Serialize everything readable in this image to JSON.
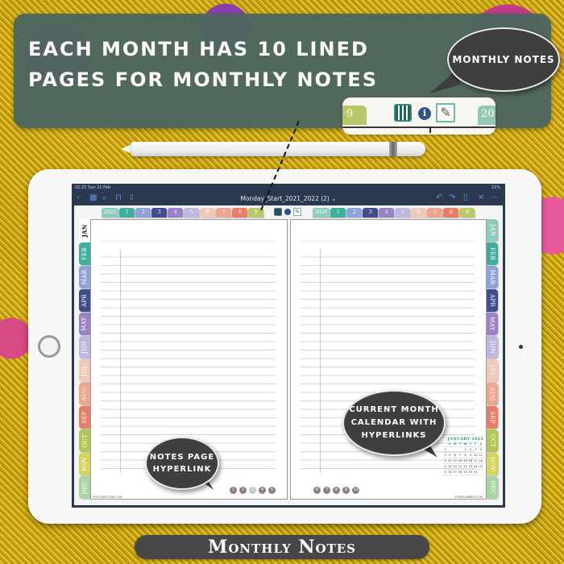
{
  "banner": {
    "title": "EACH MONTH HAS 10 LINED PAGES FOR MONTHLY NOTES",
    "zoom_strip": {
      "tab_left": "9",
      "tab_right": "20"
    }
  },
  "callouts": {
    "monthly_notes": "MONTHLY NOTES",
    "notes_page_hyperlink": "NOTES PAGE HYPERLINK",
    "current_month_calendar": "CURRENT MONTH CALENDAR WITH HYPERLINKS"
  },
  "app": {
    "status_time": "02:25",
    "status_date": "Sun 21 Feb",
    "status_right": "21%",
    "document_title": "Monday_Start_2021_2022 (2) ⌄",
    "toolbar_left_icons": [
      "back-icon",
      "grid-icon",
      "search-icon",
      "bookmark-icon",
      "share-icon"
    ],
    "toolbar_right_icons": [
      "undo-icon",
      "redo-icon",
      "export-icon",
      "close-icon",
      "more-icon"
    ]
  },
  "planner": {
    "left_page": {
      "year_tabs": [
        {
          "label": "2025",
          "color": "#8fcbbd"
        },
        {
          "label": "1",
          "color": "#3fae9f"
        },
        {
          "label": "2",
          "color": "#8fa3d6"
        },
        {
          "label": "3",
          "color": "#414c8c"
        },
        {
          "label": "4",
          "color": "#9b82c6"
        },
        {
          "label": "5",
          "color": "#c0b7e0"
        },
        {
          "label": "6",
          "color": "#f0c9b8"
        },
        {
          "label": "7",
          "color": "#eea58f"
        },
        {
          "label": "8",
          "color": "#e77d66"
        },
        {
          "label": "9",
          "color": "#b9c86a"
        }
      ],
      "month_tabs": [
        {
          "label": "JAN",
          "color": "#ffffff",
          "active": true
        },
        {
          "label": "FEB",
          "color": "#3fae9f"
        },
        {
          "label": "MAR",
          "color": "#8fa3d6"
        },
        {
          "label": "APR",
          "color": "#414c8c"
        },
        {
          "label": "MAY",
          "color": "#9b82c6"
        },
        {
          "label": "JUN",
          "color": "#c0b7e0"
        },
        {
          "label": "JUL",
          "color": "#f0c9b8"
        },
        {
          "label": "AUG",
          "color": "#eea58f"
        },
        {
          "label": "SEP",
          "color": "#e77d66"
        },
        {
          "label": "OCT",
          "color": "#b2c556"
        },
        {
          "label": "NOV",
          "color": "#d4d55a"
        },
        {
          "label": "DEC",
          "color": "#a9d3a2"
        }
      ],
      "page_links": [
        "1",
        "2",
        "3",
        "4",
        "5"
      ],
      "current_page": "3"
    },
    "right_page": {
      "year_tabs": [
        {
          "label": "2026",
          "color": "#8fcbbd"
        },
        {
          "label": "1",
          "color": "#3fae9f"
        },
        {
          "label": "2",
          "color": "#8fa3d6"
        },
        {
          "label": "3",
          "color": "#414c8c"
        },
        {
          "label": "4",
          "color": "#9b82c6"
        },
        {
          "label": "5",
          "color": "#c0b7e0"
        },
        {
          "label": "6",
          "color": "#f0c9b8"
        },
        {
          "label": "7",
          "color": "#eea58f"
        },
        {
          "label": "8",
          "color": "#e77d66"
        },
        {
          "label": "9",
          "color": "#b9c86a"
        }
      ],
      "month_tabs": [
        {
          "label": "JAN",
          "color": "#8fcbbd"
        },
        {
          "label": "FEB",
          "color": "#3fae9f"
        },
        {
          "label": "MAR",
          "color": "#8fa3d6"
        },
        {
          "label": "APR",
          "color": "#414c8c"
        },
        {
          "label": "MAY",
          "color": "#9b82c6"
        },
        {
          "label": "JUN",
          "color": "#c0b7e0"
        },
        {
          "label": "JUL",
          "color": "#f0c9b8"
        },
        {
          "label": "AUG",
          "color": "#eea58f"
        },
        {
          "label": "SEP",
          "color": "#e77d66"
        },
        {
          "label": "OCT",
          "color": "#b2c556"
        },
        {
          "label": "NOV",
          "color": "#d4d55a"
        },
        {
          "label": "DEC",
          "color": "#a9d3a2"
        }
      ],
      "page_links": [
        "6",
        "7",
        "8",
        "9",
        "10"
      ]
    },
    "mini_calendar": {
      "title": "JANUARY 2025",
      "weekdays": [
        "",
        "S",
        "M",
        "T",
        "W",
        "T",
        "F",
        "S"
      ],
      "rows": [
        [
          "1",
          "",
          "",
          "",
          "1",
          "2",
          "3",
          "4"
        ],
        [
          "2",
          "5",
          "6",
          "7",
          "8",
          "9",
          "10",
          "11"
        ],
        [
          "3",
          "12",
          "13",
          "14",
          "15",
          "16",
          "17",
          "18"
        ],
        [
          "4",
          "19",
          "20",
          "21",
          "22",
          "23",
          "24",
          "25"
        ],
        [
          "5",
          "26",
          "27",
          "28",
          "29",
          "30",
          "31",
          ""
        ]
      ]
    },
    "footer_left": "PHOTOMOSTRA.COM",
    "footer_right": "STAGPLANNER.COM"
  },
  "caption": "Monthly Notes"
}
